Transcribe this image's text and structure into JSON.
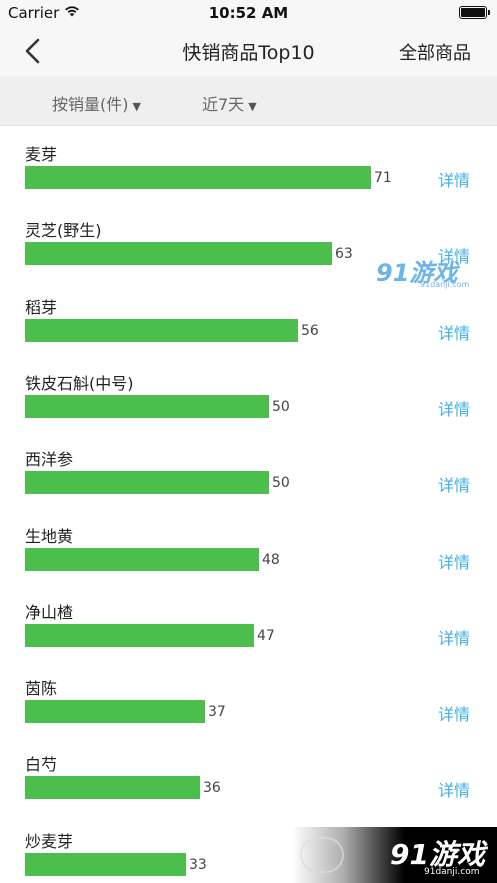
{
  "status_bar": {
    "carrier": "Carrier",
    "time": "10:52 AM"
  },
  "nav": {
    "title": "快销商品Top10",
    "right_button": "全部商品",
    "back_icon": "chevron-left-icon"
  },
  "filters": [
    {
      "label": "按销量(件)",
      "caret": "▼"
    },
    {
      "label": "近7天",
      "caret": "▼"
    }
  ],
  "chart_data": {
    "type": "bar",
    "orientation": "horizontal",
    "categories": [
      "麦芽",
      "灵芝(野生)",
      "稻芽",
      "铁皮石斛(中号)",
      "西洋参",
      "生地黄",
      "净山楂",
      "茵陈",
      "白芍",
      "炒麦芽"
    ],
    "values": [
      71,
      63,
      56,
      50,
      50,
      48,
      47,
      37,
      36,
      33
    ],
    "detail_labels": [
      "详情",
      "详情",
      "详情",
      "详情",
      "详情",
      "详情",
      "详情",
      "详情",
      "详情",
      ""
    ],
    "bar_color": "#4cbe4e",
    "xlim": [
      0,
      71
    ]
  },
  "colors": {
    "accent_link": "#3fb1e9",
    "bar": "#4cbe4e",
    "filter_bg": "#efefef"
  },
  "watermarks": {
    "top": {
      "logo": "91游戏",
      "site": "91danji.com"
    },
    "bottom": {
      "logo": "91游戏",
      "site": "91danji.com"
    }
  }
}
